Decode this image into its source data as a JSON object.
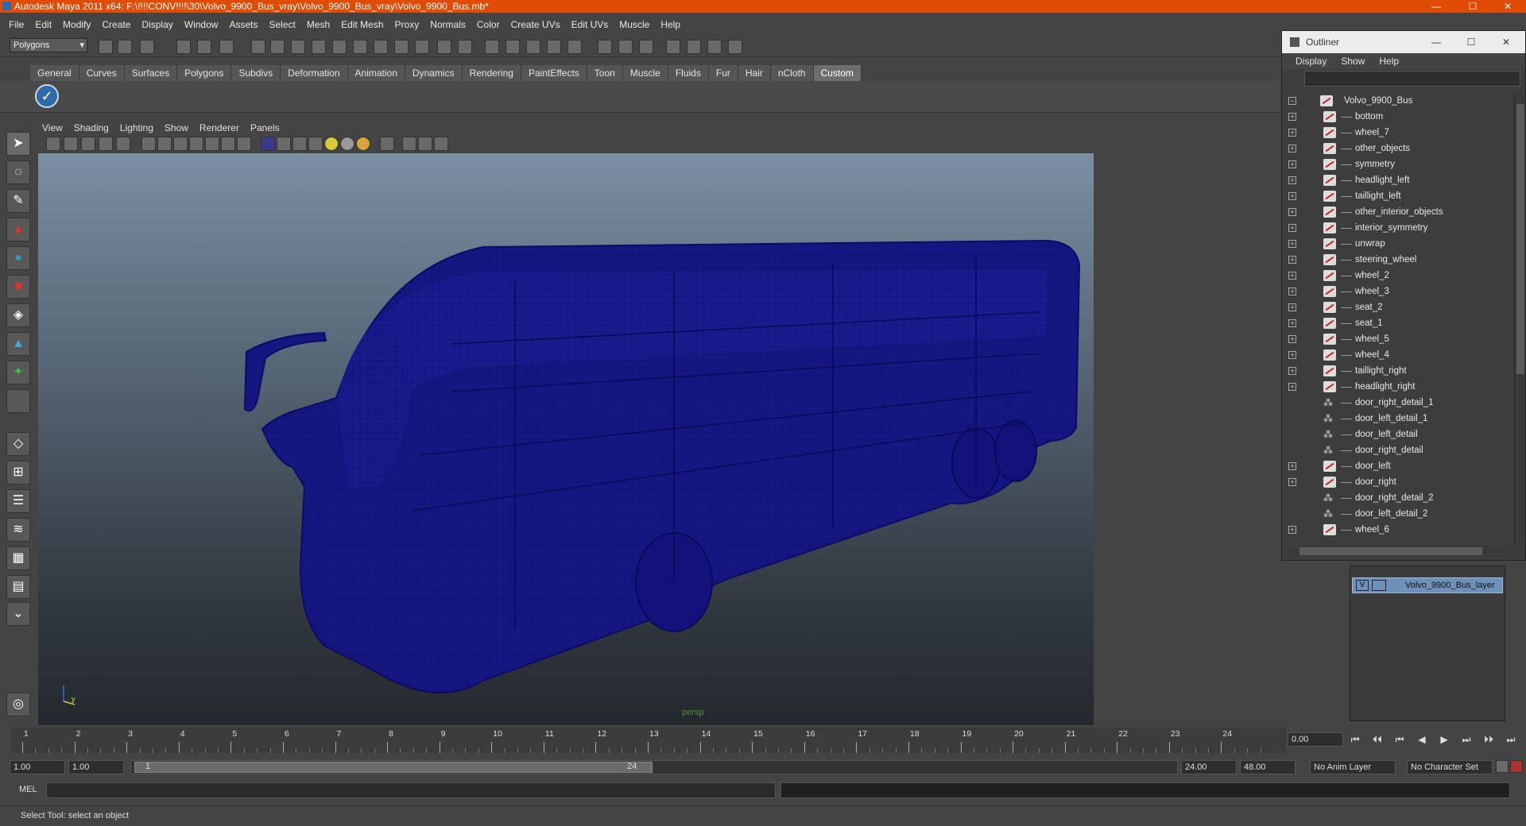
{
  "window": {
    "title": "Autodesk Maya 2011 x64: F:\\!!!!CONV!!!!\\30\\Volvo_9900_Bus_vray\\Volvo_9900_Bus_vray\\Volvo_9900_Bus.mb*",
    "min": "—",
    "max": "☐",
    "close": "✕"
  },
  "menubar": [
    "File",
    "Edit",
    "Modify",
    "Create",
    "Display",
    "Window",
    "Assets",
    "Select",
    "Mesh",
    "Edit Mesh",
    "Proxy",
    "Normals",
    "Color",
    "Create UVs",
    "Edit UVs",
    "Muscle",
    "Help"
  ],
  "toolbar": {
    "mode": "Polygons",
    "arrow": "▾"
  },
  "shelf": {
    "tabs": [
      "General",
      "Curves",
      "Surfaces",
      "Polygons",
      "Subdivs",
      "Deformation",
      "Animation",
      "Dynamics",
      "Rendering",
      "PaintEffects",
      "Toon",
      "Muscle",
      "Fluids",
      "Fur",
      "Hair",
      "nCloth",
      "Custom"
    ],
    "active_tab": "Custom",
    "check_glyph": "✓"
  },
  "panel": {
    "menu": [
      "View",
      "Shading",
      "Lighting",
      "Show",
      "Renderer",
      "Panels"
    ],
    "camera": "persp"
  },
  "outliner": {
    "title": "Outliner",
    "menu": [
      "Display",
      "Show",
      "Help"
    ],
    "root": "Volvo_9900_Bus",
    "items": [
      {
        "name": "bottom",
        "kind": "mesh"
      },
      {
        "name": "wheel_7",
        "kind": "mesh"
      },
      {
        "name": "other_objects",
        "kind": "mesh"
      },
      {
        "name": "symmetry",
        "kind": "mesh"
      },
      {
        "name": "headlight_left",
        "kind": "mesh"
      },
      {
        "name": "taillight_left",
        "kind": "mesh"
      },
      {
        "name": "other_interior_objects",
        "kind": "mesh"
      },
      {
        "name": "interior_symmetry",
        "kind": "mesh"
      },
      {
        "name": "unwrap",
        "kind": "mesh"
      },
      {
        "name": "steering_wheel",
        "kind": "mesh"
      },
      {
        "name": "wheel_2",
        "kind": "mesh"
      },
      {
        "name": "wheel_3",
        "kind": "mesh"
      },
      {
        "name": "seat_2",
        "kind": "mesh"
      },
      {
        "name": "seat_1",
        "kind": "mesh"
      },
      {
        "name": "wheel_5",
        "kind": "mesh"
      },
      {
        "name": "wheel_4",
        "kind": "mesh"
      },
      {
        "name": "taillight_right",
        "kind": "mesh"
      },
      {
        "name": "headlight_right",
        "kind": "mesh"
      },
      {
        "name": "door_right_detail_1",
        "kind": "group"
      },
      {
        "name": "door_left_detail_1",
        "kind": "group"
      },
      {
        "name": "door_left_detail",
        "kind": "group"
      },
      {
        "name": "door_right_detail",
        "kind": "group"
      },
      {
        "name": "door_left",
        "kind": "mesh"
      },
      {
        "name": "door_right",
        "kind": "mesh"
      },
      {
        "name": "door_right_detail_2",
        "kind": "group"
      },
      {
        "name": "door_left_detail_2",
        "kind": "group"
      },
      {
        "name": "wheel_6",
        "kind": "mesh"
      }
    ]
  },
  "layers": {
    "visible_flag": "V",
    "name": "Volvo_9900_Bus_layer"
  },
  "timeline": {
    "ticks": [
      "1",
      "2",
      "3",
      "4",
      "5",
      "6",
      "7",
      "8",
      "9",
      "10",
      "11",
      "12",
      "13",
      "14",
      "15",
      "16",
      "17",
      "18",
      "19",
      "20",
      "21",
      "22",
      "23",
      "24"
    ],
    "current_time": "0.00",
    "playback": [
      "⏮",
      "⏴⏴",
      "⏮",
      "◀",
      "▶",
      "⏭",
      "⏵⏵",
      "⏭"
    ]
  },
  "range": {
    "start": "1.00",
    "playback_start": "1.00",
    "slider_start": "1",
    "slider_end": "24",
    "playback_end": "24.00",
    "end": "48.00",
    "anim_layer": "No Anim Layer",
    "character_set": "No Character Set"
  },
  "cmdline": {
    "label": "MEL"
  },
  "helpline": {
    "text": "Select Tool: select an object"
  },
  "colors": {
    "titlebar": "#e04c06",
    "wireframe": "#1a1a8c",
    "selection": "#6f90b8"
  }
}
